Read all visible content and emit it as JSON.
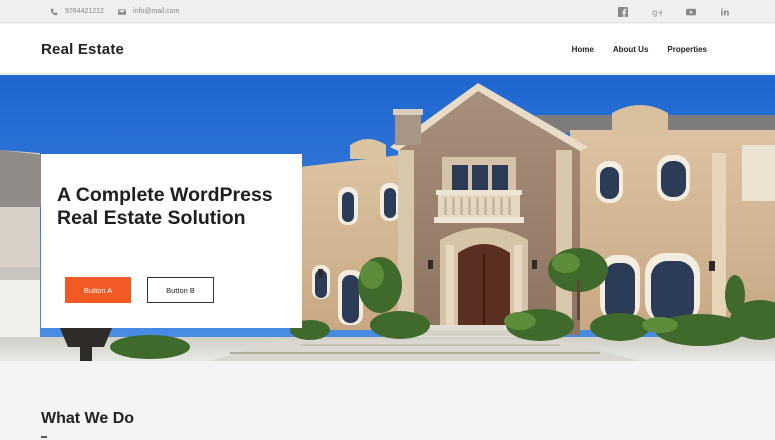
{
  "topbar": {
    "phone": "9764421212",
    "email": "info@mail.com",
    "phone_icon": "phone-icon",
    "email_icon": "envelope-icon",
    "socials": [
      "facebook-icon",
      "google-plus-icon",
      "youtube-icon",
      "linkedin-icon"
    ]
  },
  "header": {
    "logo": "Real Estate",
    "nav": [
      "Home",
      "About Us",
      "Properties"
    ]
  },
  "hero": {
    "title": "A Complete WordPress Real Estate Solution",
    "button_a": "Button A",
    "button_b": "Button B"
  },
  "section": {
    "title": "What We Do"
  },
  "colors": {
    "accent": "#f15a24",
    "sky": "#2d74d6",
    "topbar": "#efefef"
  }
}
